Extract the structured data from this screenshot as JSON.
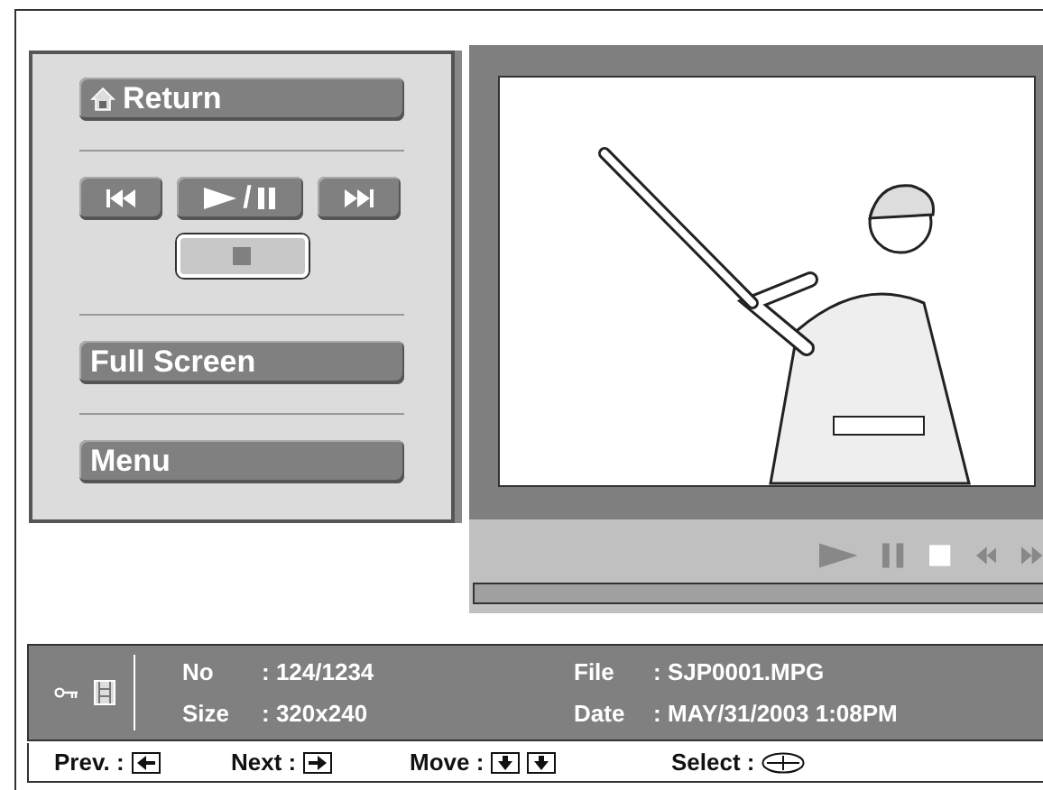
{
  "menu": {
    "return_button": {
      "label": "Return"
    },
    "transport": [
      {
        "kind": "prev",
        "selected": false
      },
      {
        "kind": "playpause",
        "label": "/",
        "selected": false
      },
      {
        "kind": "next",
        "selected": false
      },
      {
        "kind": "stop",
        "selected": true
      }
    ],
    "full_screen_button": {
      "label": "Full Screen"
    },
    "menu_button": {
      "label": "Menu"
    }
  },
  "player": {
    "controls": [
      {
        "kind": "play",
        "active": false
      },
      {
        "kind": "pause",
        "active": false
      },
      {
        "kind": "stop",
        "active": true
      },
      {
        "kind": "rewind",
        "active": false
      },
      {
        "kind": "forward",
        "active": false
      }
    ],
    "progress": {
      "level": 1
    }
  },
  "info": {
    "fields": [
      {
        "label": "No",
        "value": ": 124/1234"
      },
      {
        "label": "File",
        "value": ": SJP0001.MPG"
      },
      {
        "label": "Size",
        "value": ": 320x240"
      },
      {
        "label": "Date",
        "value": ": MAY/31/2003 1:08PM"
      }
    ]
  },
  "help": [
    {
      "label": "Prev. :",
      "keys": [
        {
          "kind": "left"
        }
      ]
    },
    {
      "label": "Next :",
      "keys": [
        {
          "kind": "right"
        }
      ]
    },
    {
      "label": "Move :",
      "keys": [
        {
          "kind": "down"
        },
        {
          "kind": "down"
        }
      ]
    },
    {
      "label": "Select :",
      "keys": [
        {
          "kind": "select"
        }
      ]
    }
  ]
}
